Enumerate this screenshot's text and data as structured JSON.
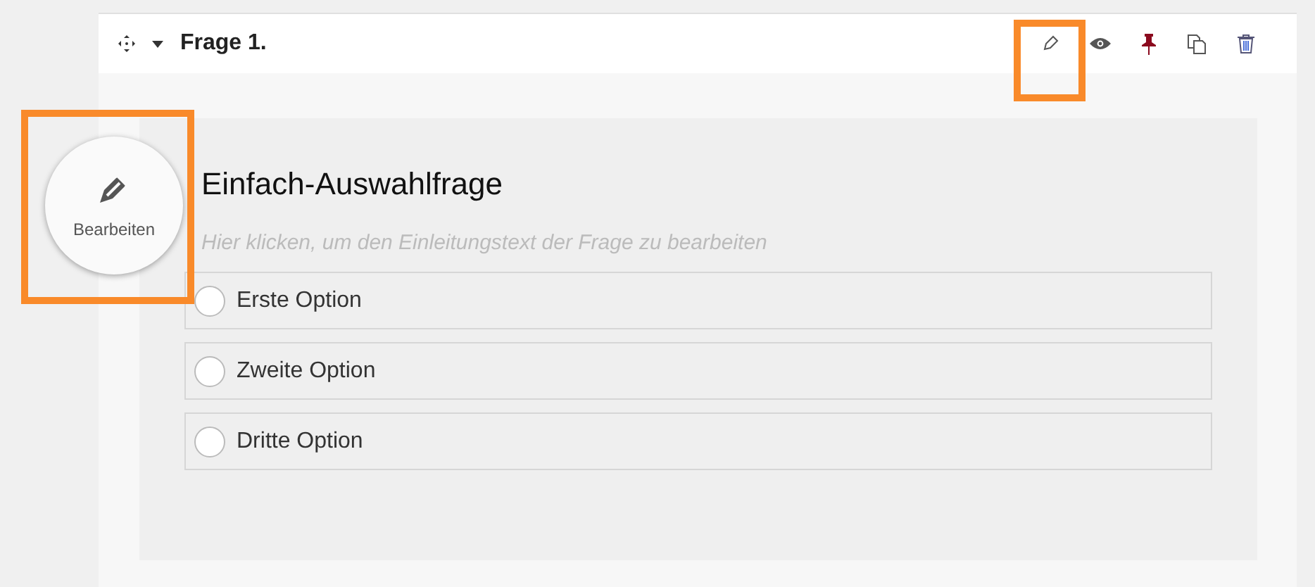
{
  "question": {
    "title": "Frage 1.",
    "expanded": true,
    "heading": "Einfach-Auswahlfrage",
    "intro_placeholder": "Hier klicken, um den Einleitungstext der Frage zu bearbeiten",
    "options": [
      {
        "label": "Erste Option",
        "selected": false
      },
      {
        "label": "Zweite Option",
        "selected": false
      },
      {
        "label": "Dritte Option",
        "selected": false
      }
    ]
  },
  "edit_bubble": {
    "label": "Bearbeiten"
  }
}
